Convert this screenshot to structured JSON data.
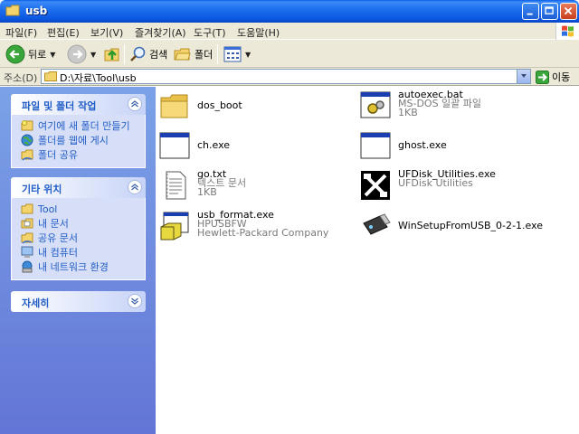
{
  "window": {
    "title": "usb"
  },
  "menu": {
    "items": [
      "파일(F)",
      "편집(E)",
      "보기(V)",
      "즐겨찾기(A)",
      "도구(T)",
      "도움말(H)"
    ]
  },
  "toolbar": {
    "back_label": "뒤로",
    "search_label": "검색",
    "folders_label": "폴더"
  },
  "address": {
    "label": "주소(D)",
    "value": "D:\\자료\\Tool\\usb",
    "go_label": "이동"
  },
  "taskpane": {
    "file_tasks": {
      "title": "파일 및 폴더 작업",
      "items": [
        "여기에 새 폴더 만들기",
        "폴더를 웹에 게시",
        "폴더 공유"
      ]
    },
    "other_places": {
      "title": "기타 위치",
      "items": [
        "Tool",
        "내 문서",
        "공유 문서",
        "내 컴퓨터",
        "내 네트워크 환경"
      ]
    },
    "details": {
      "title": "자세히"
    }
  },
  "files": [
    {
      "name": "dos_boot",
      "line2": "",
      "line3": "",
      "icon": "folder-icon"
    },
    {
      "name": "autoexec.bat",
      "line2": "MS-DOS 일괄 파일",
      "line3": "1KB",
      "icon": "batch-file-icon"
    },
    {
      "name": "ch.exe",
      "line2": "",
      "line3": "",
      "icon": "exe-window-icon"
    },
    {
      "name": "ghost.exe",
      "line2": "",
      "line3": "",
      "icon": "exe-window-icon"
    },
    {
      "name": "go.txt",
      "line2": "텍스트 문서",
      "line3": "1KB",
      "icon": "text-file-icon"
    },
    {
      "name": "UFDisk_Utilities.exe",
      "line2": "UFDisk Utilities",
      "line3": "",
      "icon": "ufdisk-icon"
    },
    {
      "name": "usb_format.exe",
      "line2": "HPUSBFW",
      "line3": "Hewlett-Packard Company",
      "icon": "installer-icon"
    },
    {
      "name": "WinSetupFromUSB_0-2-1.exe",
      "line2": "",
      "line3": "",
      "icon": "usb-stick-icon"
    }
  ]
}
